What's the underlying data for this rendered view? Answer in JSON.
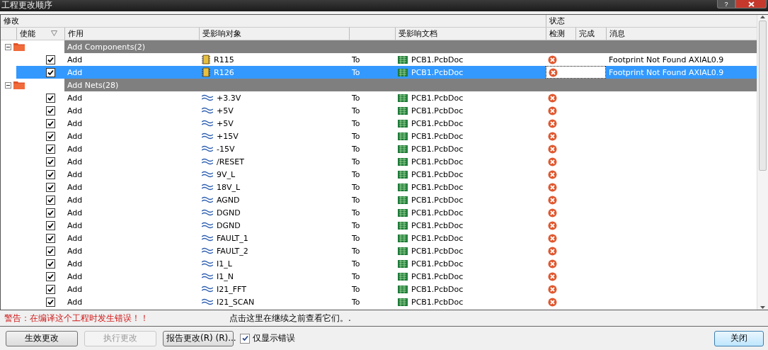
{
  "window": {
    "title": "工程更改顺序",
    "help_label": "?"
  },
  "header": {
    "group_modify": "修改",
    "group_status": "状态"
  },
  "columns": {
    "enable": "使能",
    "action": "作用",
    "object": "受影响对象",
    "document": "受影响文档",
    "check": "检测",
    "done": "完成",
    "message": "消息"
  },
  "sections": [
    {
      "label": "Add Components(2)",
      "expanded": true,
      "rows": [
        {
          "checked": true,
          "action": "Add",
          "kind": "component",
          "object": "R115",
          "to": "To",
          "document": "PCB1.PcbDoc",
          "error": true,
          "message": "Footprint Not Found AXIAL0.9",
          "selected": false
        },
        {
          "checked": true,
          "action": "Add",
          "kind": "component",
          "object": "R126",
          "to": "To",
          "document": "PCB1.PcbDoc",
          "error": true,
          "message": "Footprint Not Found AXIAL0.9",
          "selected": true
        }
      ]
    },
    {
      "label": "Add Nets(28)",
      "expanded": true,
      "rows": [
        {
          "checked": true,
          "action": "Add",
          "kind": "net",
          "object": "+3.3V",
          "to": "To",
          "document": "PCB1.PcbDoc",
          "error": true,
          "selected": false
        },
        {
          "checked": true,
          "action": "Add",
          "kind": "net",
          "object": "+5V",
          "to": "To",
          "document": "PCB1.PcbDoc",
          "error": true,
          "selected": false
        },
        {
          "checked": true,
          "action": "Add",
          "kind": "net",
          "object": "+5V",
          "to": "To",
          "document": "PCB1.PcbDoc",
          "error": true,
          "selected": false
        },
        {
          "checked": true,
          "action": "Add",
          "kind": "net",
          "object": "+15V",
          "to": "To",
          "document": "PCB1.PcbDoc",
          "error": true,
          "selected": false
        },
        {
          "checked": true,
          "action": "Add",
          "kind": "net",
          "object": "-15V",
          "to": "To",
          "document": "PCB1.PcbDoc",
          "error": true,
          "selected": false
        },
        {
          "checked": true,
          "action": "Add",
          "kind": "net",
          "object": "/RESET",
          "to": "To",
          "document": "PCB1.PcbDoc",
          "error": true,
          "selected": false
        },
        {
          "checked": true,
          "action": "Add",
          "kind": "net",
          "object": "9V_L",
          "to": "To",
          "document": "PCB1.PcbDoc",
          "error": true,
          "selected": false
        },
        {
          "checked": true,
          "action": "Add",
          "kind": "net",
          "object": "18V_L",
          "to": "To",
          "document": "PCB1.PcbDoc",
          "error": true,
          "selected": false
        },
        {
          "checked": true,
          "action": "Add",
          "kind": "net",
          "object": "AGND",
          "to": "To",
          "document": "PCB1.PcbDoc",
          "error": true,
          "selected": false
        },
        {
          "checked": true,
          "action": "Add",
          "kind": "net",
          "object": "DGND",
          "to": "To",
          "document": "PCB1.PcbDoc",
          "error": true,
          "selected": false
        },
        {
          "checked": true,
          "action": "Add",
          "kind": "net",
          "object": "DGND",
          "to": "To",
          "document": "PCB1.PcbDoc",
          "error": true,
          "selected": false
        },
        {
          "checked": true,
          "action": "Add",
          "kind": "net",
          "object": "FAULT_1",
          "to": "To",
          "document": "PCB1.PcbDoc",
          "error": true,
          "selected": false
        },
        {
          "checked": true,
          "action": "Add",
          "kind": "net",
          "object": "FAULT_2",
          "to": "To",
          "document": "PCB1.PcbDoc",
          "error": true,
          "selected": false
        },
        {
          "checked": true,
          "action": "Add",
          "kind": "net",
          "object": "I1_L",
          "to": "To",
          "document": "PCB1.PcbDoc",
          "error": true,
          "selected": false
        },
        {
          "checked": true,
          "action": "Add",
          "kind": "net",
          "object": "I1_N",
          "to": "To",
          "document": "PCB1.PcbDoc",
          "error": true,
          "selected": false
        },
        {
          "checked": true,
          "action": "Add",
          "kind": "net",
          "object": "I21_FFT",
          "to": "To",
          "document": "PCB1.PcbDoc",
          "error": true,
          "selected": false
        },
        {
          "checked": true,
          "action": "Add",
          "kind": "net",
          "object": "I21_SCAN",
          "to": "To",
          "document": "PCB1.PcbDoc",
          "error": true,
          "selected": false
        }
      ]
    }
  ],
  "warning": {
    "text": "警告：在编译这个工程时发生错误！！",
    "hint": "点击这里在继续之前查看它们。."
  },
  "buttons": [
    {
      "label": "生效更改",
      "disabled": false
    },
    {
      "label": "执行更改",
      "disabled": true
    },
    {
      "label": "报告更改(R) (R)...",
      "disabled": false
    }
  ],
  "only_errors": {
    "label": "仅显示错误",
    "checked": true
  },
  "close_button": "关闭"
}
